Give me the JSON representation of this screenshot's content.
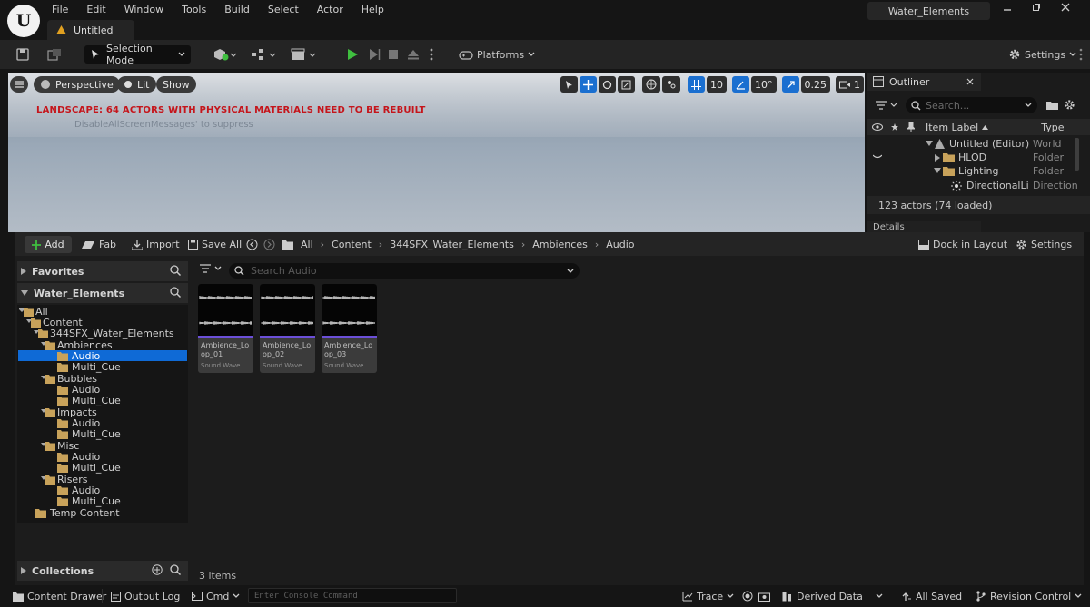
{
  "menu": [
    "File",
    "Edit",
    "Window",
    "Tools",
    "Build",
    "Select",
    "Actor",
    "Help"
  ],
  "document_tab": "Untitled",
  "project_name": "Water_Elements",
  "toolbar": {
    "selection_mode": "Selection Mode",
    "platforms": "Platforms",
    "settings": "Settings"
  },
  "viewport": {
    "perspective": "Perspective",
    "lit": "Lit",
    "show": "Show",
    "warning": "LANDSCAPE: 64 ACTORS WITH PHYSICAL MATERIALS NEED TO BE REBUILT",
    "hint": "DisableAllScreenMessages' to suppress",
    "grid_snap": "10",
    "rotation_snap": "10°",
    "scale_snap": "0.25",
    "camera_speed": "1"
  },
  "outliner": {
    "tab": "Outliner",
    "search_placeholder": "Search...",
    "col_label": "Item Label",
    "col_type": "Type",
    "rows": [
      {
        "label": "Untitled (Editor)",
        "type": "World"
      },
      {
        "label": "HLOD",
        "type": "Folder"
      },
      {
        "label": "Lighting",
        "type": "Folder"
      },
      {
        "label": "DirectionalLigl",
        "type": "Direction"
      }
    ],
    "count": "123 actors (74 loaded)",
    "details_tab": "Details"
  },
  "content_browser": {
    "add": "Add",
    "fab": "Fab",
    "import": "Import",
    "save_all": "Save All",
    "breadcrumbs": [
      "All",
      "Content",
      "344SFX_Water_Elements",
      "Ambiences",
      "Audio"
    ],
    "dock": "Dock in Layout",
    "settings": "Settings",
    "favorites": "Favorites",
    "project_section": "Water_Elements",
    "collections": "Collections",
    "search_placeholder": "Search Audio",
    "tree": [
      "All",
      "Content",
      "344SFX_Water_Elements",
      "Ambiences",
      "Audio",
      "Multi_Cue",
      "Bubbles",
      "Audio",
      "Multi_Cue",
      "Impacts",
      "Audio",
      "Multi_Cue",
      "Misc",
      "Audio",
      "Multi_Cue",
      "Risers",
      "Audio",
      "Multi_Cue",
      "Temp Content"
    ],
    "assets": [
      {
        "name": "Ambience_Loop_01",
        "type": "Sound Wave"
      },
      {
        "name": "Ambience_Loop_02",
        "type": "Sound Wave"
      },
      {
        "name": "Ambience_Loop_03",
        "type": "Sound Wave"
      }
    ],
    "item_count": "3 items"
  },
  "statusbar": {
    "content_drawer": "Content Drawer",
    "output_log": "Output Log",
    "cmd": "Cmd",
    "console_placeholder": "Enter Console Command",
    "trace": "Trace",
    "derived_data": "Derived Data",
    "all_saved": "All Saved",
    "revision_control": "Revision Control"
  },
  "colors": {
    "accent_blue": "#0f6ad6",
    "play_green": "#3fbf3f",
    "warning_red": "#c5151b",
    "folder": "#c8a25a",
    "sound_wave": "#6b4fd8"
  }
}
